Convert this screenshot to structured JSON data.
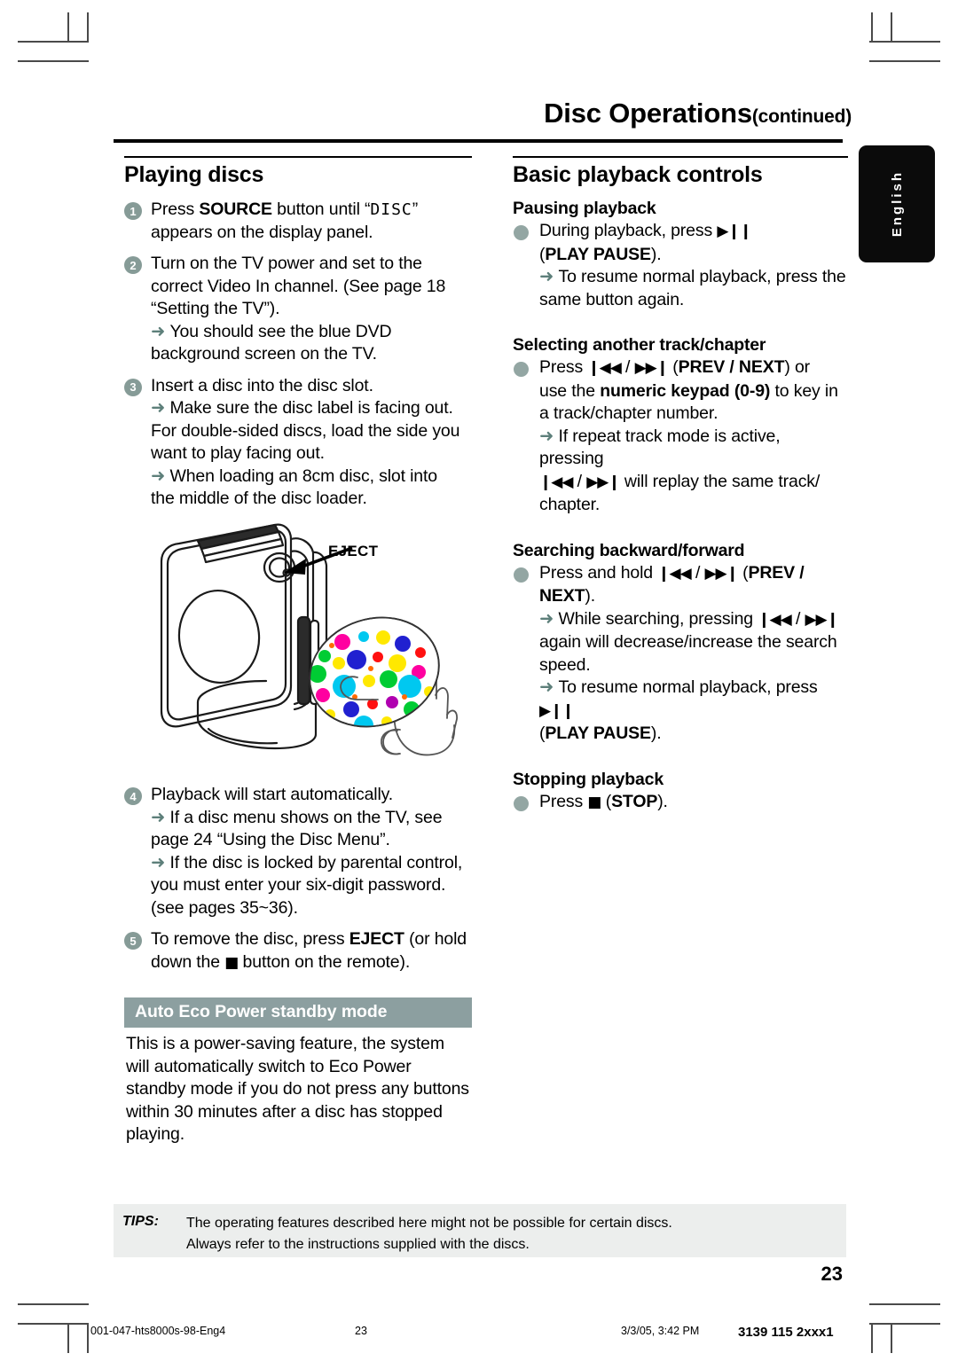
{
  "header": {
    "title": "Disc Operations",
    "title_suffix": "(continued)"
  },
  "lang_tab": {
    "label": "English"
  },
  "left_column": {
    "heading": "Playing discs",
    "steps": [
      {
        "num": "1",
        "lines": [
          {
            "parts": [
              {
                "t": "Press ",
                "s": "n"
              },
              {
                "t": "SOURCE",
                "s": "b"
              },
              {
                "t": " button until “",
                "s": "n"
              },
              {
                "t": "DISC",
                "s": "lcd"
              },
              {
                "t": "”",
                "s": "n"
              }
            ]
          },
          {
            "parts": [
              {
                "t": "appears on the display panel.",
                "s": "n"
              }
            ]
          }
        ]
      },
      {
        "num": "2",
        "lines": [
          {
            "parts": [
              {
                "t": "Turn on the TV power and set to the",
                "s": "n"
              }
            ]
          },
          {
            "parts": [
              {
                "t": "correct Video In channel.  (See page 18",
                "s": "n"
              }
            ]
          },
          {
            "parts": [
              {
                "t": "“Setting the TV”).",
                "s": "n"
              }
            ]
          },
          {
            "parts": [
              {
                "t": "➜ ",
                "s": "a"
              },
              {
                "t": "You should see the blue DVD",
                "s": "n"
              }
            ]
          },
          {
            "parts": [
              {
                "t": "background screen on the TV.",
                "s": "n"
              }
            ]
          }
        ]
      },
      {
        "num": "3",
        "lines": [
          {
            "parts": [
              {
                "t": "Insert a disc into the disc slot.",
                "s": "n"
              }
            ]
          },
          {
            "parts": [
              {
                "t": "➜ ",
                "s": "a"
              },
              {
                "t": "Make sure the disc label is facing out.",
                "s": "n"
              }
            ]
          },
          {
            "parts": [
              {
                "t": "For double-sided discs, load the side you",
                "s": "n"
              }
            ]
          },
          {
            "parts": [
              {
                "t": "want to play facing out.",
                "s": "n"
              }
            ]
          },
          {
            "parts": [
              {
                "t": "➜ ",
                "s": "a"
              },
              {
                "t": "When loading an 8cm disc, slot into",
                "s": "n"
              }
            ]
          },
          {
            "parts": [
              {
                "t": "the middle of the disc loader.",
                "s": "n"
              }
            ]
          }
        ]
      },
      {
        "num": "4",
        "lines": [
          {
            "parts": [
              {
                "t": "Playback will start automatically.",
                "s": "n"
              }
            ]
          },
          {
            "parts": [
              {
                "t": "➜ ",
                "s": "a"
              },
              {
                "t": "If a disc menu shows on the TV, see",
                "s": "n"
              }
            ]
          },
          {
            "parts": [
              {
                "t": "page 24 “Using the Disc Menu”.",
                "s": "n"
              }
            ]
          },
          {
            "parts": [
              {
                "t": "➜ ",
                "s": "a"
              },
              {
                "t": "If the disc is locked by parental control,",
                "s": "n"
              }
            ]
          },
          {
            "parts": [
              {
                "t": "you must enter your six-digit password.",
                "s": "n"
              }
            ]
          },
          {
            "parts": [
              {
                "t": "(see pages 35~36).",
                "s": "n"
              }
            ]
          }
        ]
      },
      {
        "num": "5",
        "lines": [
          {
            "parts": [
              {
                "t": "To remove the disc, press ",
                "s": "n"
              },
              {
                "t": "EJECT",
                "s": "b"
              },
              {
                "t": " (or hold",
                "s": "n"
              }
            ]
          },
          {
            "parts": [
              {
                "t": "down the ",
                "s": "n"
              },
              {
                "t": "■",
                "s": "g"
              },
              {
                "t": " button on the remote).",
                "s": "n"
              }
            ]
          }
        ]
      }
    ],
    "eco_box": {
      "heading": "Auto Eco Power standby mode",
      "body": "This is a power-saving feature, the system will automatically switch to Eco Power standby mode if you do not press any buttons within 30 minutes after a disc has stopped playing."
    },
    "illustration": {
      "callout_label": "EJECT",
      "description": "line drawing of DVD player with disc slot and a hand inserting a polka-dot disc",
      "arrow_color": "#f0a93c",
      "disc_dot_colors": [
        "#ff00a0",
        "#00c8f0",
        "#ffe800",
        "#00cc33",
        "#2020d0",
        "#ff1010",
        "#b000b0"
      ]
    }
  },
  "right_column": {
    "heading": "Basic playback controls",
    "sections": [
      {
        "title": "Pausing playback",
        "bullet": true,
        "lines": [
          {
            "parts": [
              {
                "t": "During playback, press ",
                "s": "n"
              },
              {
                "t": "▶❙❙",
                "s": "g"
              }
            ]
          },
          {
            "parts": [
              {
                "t": "(",
                "s": "n"
              },
              {
                "t": "PLAY PAUSE",
                "s": "b"
              },
              {
                "t": ").",
                "s": "n"
              }
            ]
          },
          {
            "parts": [
              {
                "t": "➜ ",
                "s": "a"
              },
              {
                "t": "To resume normal playback, press the",
                "s": "n"
              }
            ]
          },
          {
            "parts": [
              {
                "t": "same button again.",
                "s": "n"
              }
            ]
          }
        ]
      },
      {
        "title": "Selecting another track/chapter",
        "bullet": true,
        "lines": [
          {
            "parts": [
              {
                "t": "Press ",
                "s": "n"
              },
              {
                "t": "❙◀◀",
                "s": "g"
              },
              {
                "t": " / ",
                "s": "n"
              },
              {
                "t": "▶▶❙",
                "s": "g"
              },
              {
                "t": "  (",
                "s": "n"
              },
              {
                "t": "PREV / NEXT",
                "s": "b"
              },
              {
                "t": ") or",
                "s": "n"
              }
            ]
          },
          {
            "parts": [
              {
                "t": "use the ",
                "s": "n"
              },
              {
                "t": "numeric keypad (0-9)",
                "s": "b"
              },
              {
                "t": " to key in",
                "s": "n"
              }
            ]
          },
          {
            "parts": [
              {
                "t": "a track/chapter number.",
                "s": "n"
              }
            ]
          },
          {
            "parts": [
              {
                "t": "➜ ",
                "s": "a"
              },
              {
                "t": "If repeat track mode is active, pressing",
                "s": "n"
              }
            ]
          },
          {
            "parts": [
              {
                "t": "❙◀◀",
                "s": "g"
              },
              {
                "t": " / ",
                "s": "n"
              },
              {
                "t": "▶▶❙",
                "s": "g"
              },
              {
                "t": "  will replay the same track/",
                "s": "n"
              }
            ]
          },
          {
            "parts": [
              {
                "t": "chapter.",
                "s": "n"
              }
            ]
          }
        ]
      },
      {
        "title": "Searching backward/forward",
        "bullet": true,
        "lines": [
          {
            "parts": [
              {
                "t": "Press and hold ",
                "s": "n"
              },
              {
                "t": "❙◀◀",
                "s": "g"
              },
              {
                "t": " / ",
                "s": "n"
              },
              {
                "t": "▶▶❙",
                "s": "g"
              },
              {
                "t": "  (",
                "s": "n"
              },
              {
                "t": "PREV /",
                "s": "b"
              }
            ]
          },
          {
            "parts": [
              {
                "t": "NEXT",
                "s": "b"
              },
              {
                "t": ").",
                "s": "n"
              }
            ]
          },
          {
            "parts": [
              {
                "t": "➜ ",
                "s": "a"
              },
              {
                "t": "While searching, pressing ",
                "s": "n"
              },
              {
                "t": "❙◀◀",
                "s": "g"
              },
              {
                "t": " / ",
                "s": "n"
              },
              {
                "t": "▶▶❙",
                "s": "g"
              }
            ]
          },
          {
            "parts": [
              {
                "t": "again will decrease/increase the search",
                "s": "n"
              }
            ]
          },
          {
            "parts": [
              {
                "t": "speed.",
                "s": "n"
              }
            ]
          },
          {
            "parts": [
              {
                "t": "➜ ",
                "s": "a"
              },
              {
                "t": "To resume normal playback, press ",
                "s": "n"
              },
              {
                "t": "▶❙❙",
                "s": "g"
              }
            ]
          },
          {
            "parts": [
              {
                "t": "(",
                "s": "n"
              },
              {
                "t": "PLAY PAUSE",
                "s": "b"
              },
              {
                "t": ").",
                "s": "n"
              }
            ]
          }
        ]
      },
      {
        "title": "Stopping playback",
        "bullet": true,
        "lines": [
          {
            "parts": [
              {
                "t": "Press ",
                "s": "n"
              },
              {
                "t": "■",
                "s": "g"
              },
              {
                "t": "  (",
                "s": "n"
              },
              {
                "t": "STOP",
                "s": "b"
              },
              {
                "t": ").",
                "s": "n"
              }
            ]
          }
        ]
      }
    ]
  },
  "tips": {
    "label": "TIPS:",
    "line1": "The operating features described here might not be possible for certain discs.",
    "line2": "Always refer to the instructions supplied with the discs."
  },
  "page_number": "23",
  "footer": {
    "file": "001-047-hts8000s-98-Eng4",
    "page": "23",
    "date": "3/3/05, 3:42 PM",
    "code": "3139 115 2xxx1"
  },
  "colors": {
    "bullet": "#869b97",
    "arrow": "#5d7f7a",
    "eco_header_bg": "#8c9fa0",
    "tips_bg": "#eceeed",
    "tab_bg": "#0b0b0b"
  }
}
